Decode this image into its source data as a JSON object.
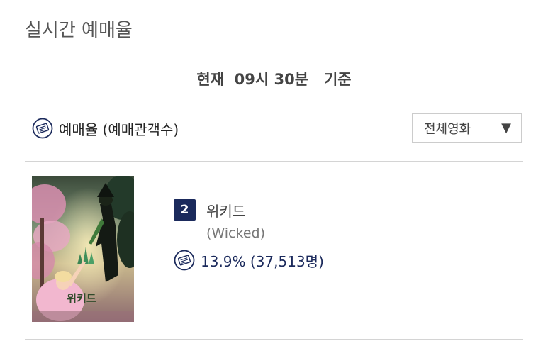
{
  "page": {
    "title": "실시간 예매율",
    "basis_time": "현재  09시 30분   기준"
  },
  "rate_header": {
    "label": "예매율 (예매관객수)",
    "icon": "ticket-icon"
  },
  "filter": {
    "selected": "전체영화",
    "arrow": "▼"
  },
  "movies": [
    {
      "rank": "2",
      "title": "위키드",
      "english_title": "(Wicked)",
      "rate": "13.9% (37,513명)",
      "poster_text": "위키드"
    }
  ],
  "colors": {
    "accent": "#1b2a5c",
    "text_gray": "#555555",
    "divider": "#d4d4d4"
  }
}
